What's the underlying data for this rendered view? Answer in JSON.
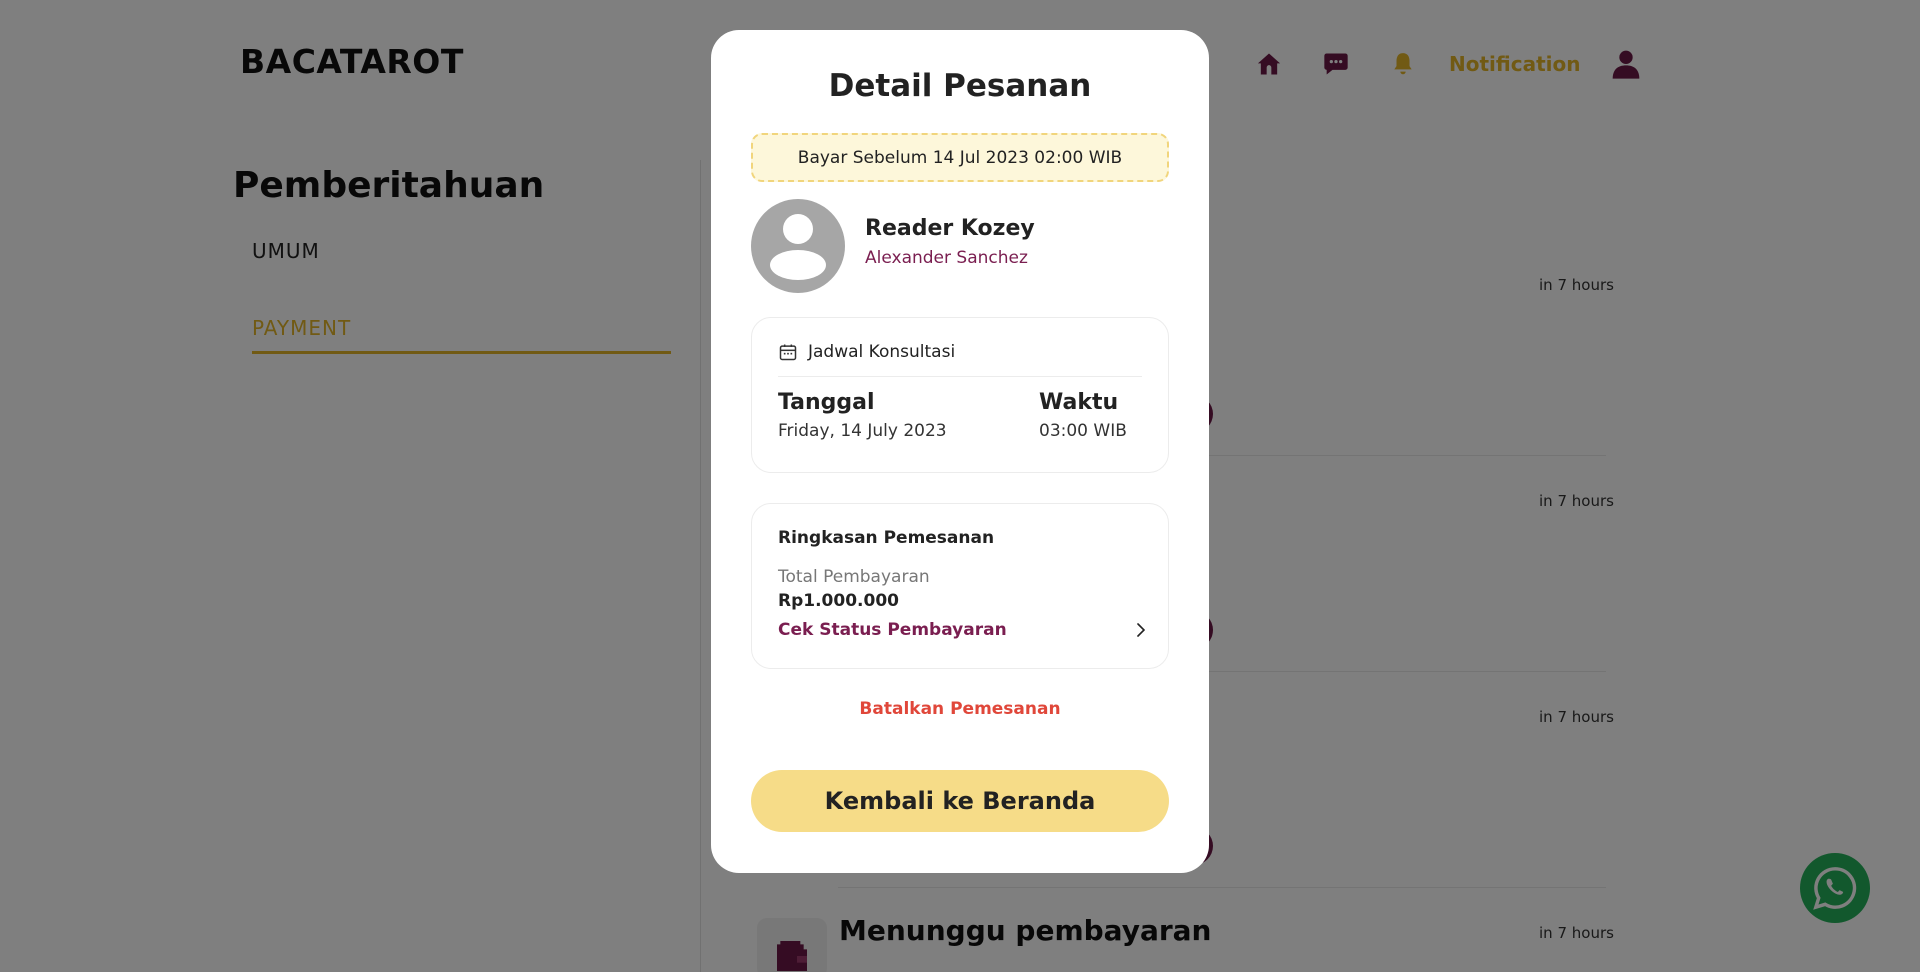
{
  "header": {
    "brand": "BACATAROT",
    "notification_label": "Notification",
    "icons": [
      "home-icon",
      "chat-icon",
      "bell-icon",
      "profile-icon"
    ]
  },
  "sidebar": {
    "title": "Pemberitahuan",
    "tabs": [
      {
        "label": "UMUM",
        "active": false
      },
      {
        "label": "PAYMENT",
        "active": true
      }
    ]
  },
  "notifications": {
    "items": [
      {
        "time": "in 7 hours"
      },
      {
        "time": "in 7 hours"
      },
      {
        "time": "in 7 hours"
      },
      {
        "time": "in 7 hours",
        "title": "Menunggu pembayaran"
      }
    ]
  },
  "modal": {
    "title": "Detail Pesanan",
    "deadline": "Bayar Sebelum 14 Jul 2023 02:00 WIB",
    "reader_name": "Reader Kozey",
    "client_name": "Alexander Sanchez",
    "schedule": {
      "heading": "Jadwal Konsultasi",
      "date_label": "Tanggal",
      "date_value": "Friday, 14 July 2023",
      "time_label": "Waktu",
      "time_value": "03:00 WIB"
    },
    "summary": {
      "heading": "Ringkasan Pemesanan",
      "total_label": "Total Pembayaran",
      "total_value": "Rp1.000.000",
      "status_link": "Cek Status Pembayaran"
    },
    "cancel_label": "Batalkan Pemesanan",
    "home_button": "Kembali ke Beranda"
  },
  "colors": {
    "accent_gold": "#e2b428",
    "brand_maroon": "#6b1846",
    "button_yellow": "#f6dc88",
    "danger_red": "#e0473a",
    "whatsapp_green": "#25b05a"
  }
}
